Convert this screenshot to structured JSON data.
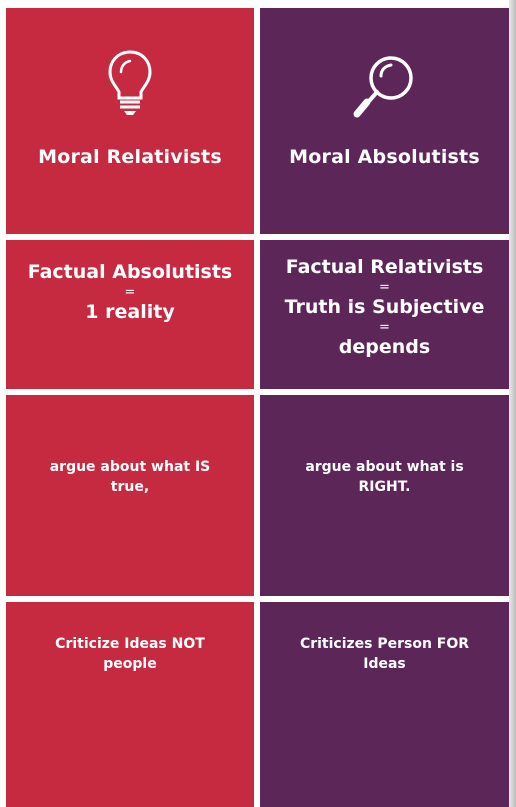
{
  "header": {
    "left_title": "Moral Relativists",
    "right_title": "Moral Absolutists",
    "left_icon": "lightbulb-icon",
    "right_icon": "magnifier-icon"
  },
  "row2": {
    "left": {
      "line1": "Factual Absolutists",
      "eq1": "=",
      "line2": "1 reality"
    },
    "right": {
      "line1": "Factual Relativists",
      "eq1": "=",
      "line2": "Truth is Subjective",
      "eq2": "=",
      "line3": "depends"
    }
  },
  "row3": {
    "left": {
      "line1": "argue about what IS",
      "line2": "true,"
    },
    "right": {
      "line1": "argue about what is",
      "line2": "RIGHT."
    }
  },
  "row4": {
    "left": {
      "line1": "Criticize Ideas NOT",
      "line2": "people"
    },
    "right": {
      "line1": "Criticizes Person FOR",
      "line2": "Ideas"
    }
  },
  "colors": {
    "red": "#c52a41",
    "purple": "#5d2659",
    "text": "#ffffff"
  }
}
